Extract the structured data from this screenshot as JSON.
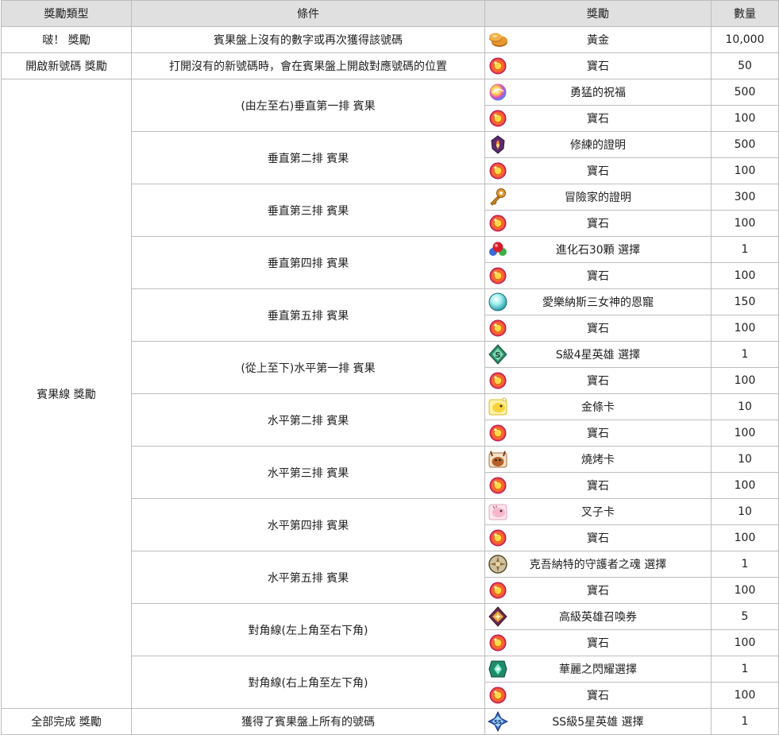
{
  "headers": [
    "獎勵類型",
    "條件",
    "獎勵",
    "數量"
  ],
  "rows": [
    {
      "type": "啵！ 獎勵",
      "condition": "賓果盤上沒有的數字或再次獲得該號碼",
      "rewards": [
        {
          "name": "黃金",
          "qty": "10,000",
          "icon": "gold-coins-icon"
        }
      ]
    },
    {
      "type": "開啟新號碼 獎勵",
      "condition": "打開沒有的新號碼時，會在賓果盤上開啟對應號碼的位置",
      "rewards": [
        {
          "name": "寶石",
          "qty": "50",
          "icon": "gem-icon"
        }
      ]
    },
    {
      "type": "賓果線 獎勵",
      "condition": "(由左至右)垂直第一排 賓果",
      "rewards": [
        {
          "name": "勇猛的祝福",
          "qty": "500",
          "icon": "blessing-orb-icon"
        },
        {
          "name": "寶石",
          "qty": "100",
          "icon": "gem-icon"
        }
      ]
    },
    {
      "condition": "垂直第二排 賓果",
      "rewards": [
        {
          "name": "修練的證明",
          "qty": "500",
          "icon": "training-proof-icon"
        },
        {
          "name": "寶石",
          "qty": "100",
          "icon": "gem-icon"
        }
      ]
    },
    {
      "condition": "垂直第三排 賓果",
      "rewards": [
        {
          "name": "冒險家的證明",
          "qty": "300",
          "icon": "key-icon"
        },
        {
          "name": "寶石",
          "qty": "100",
          "icon": "gem-icon"
        }
      ]
    },
    {
      "condition": "垂直第四排 賓果",
      "rewards": [
        {
          "name": "進化石30顆 選擇",
          "qty": "1",
          "icon": "evolution-stones-icon"
        },
        {
          "name": "寶石",
          "qty": "100",
          "icon": "gem-icon"
        }
      ]
    },
    {
      "condition": "垂直第五排 賓果",
      "rewards": [
        {
          "name": "愛樂納斯三女神的恩寵",
          "qty": "150",
          "icon": "goddess-orb-icon"
        },
        {
          "name": "寶石",
          "qty": "100",
          "icon": "gem-icon"
        }
      ]
    },
    {
      "condition": "(從上至下)水平第一排 賓果",
      "rewards": [
        {
          "name": "S級4星英雄 選擇",
          "qty": "1",
          "icon": "hero-ticket-icon"
        },
        {
          "name": "寶石",
          "qty": "100",
          "icon": "gem-icon"
        }
      ]
    },
    {
      "condition": "水平第二排 賓果",
      "rewards": [
        {
          "name": "金條卡",
          "qty": "10",
          "icon": "gold-bar-card-icon"
        },
        {
          "name": "寶石",
          "qty": "100",
          "icon": "gem-icon"
        }
      ]
    },
    {
      "condition": "水平第三排 賓果",
      "rewards": [
        {
          "name": "燒烤卡",
          "qty": "10",
          "icon": "bbq-card-icon"
        },
        {
          "name": "寶石",
          "qty": "100",
          "icon": "gem-icon"
        }
      ]
    },
    {
      "condition": "水平第四排 賓果",
      "rewards": [
        {
          "name": "叉子卡",
          "qty": "10",
          "icon": "fork-card-icon"
        },
        {
          "name": "寶石",
          "qty": "100",
          "icon": "gem-icon"
        }
      ]
    },
    {
      "condition": "水平第五排 賓果",
      "rewards": [
        {
          "name": "克吾納特的守護者之魂 選擇",
          "qty": "1",
          "icon": "guardian-soul-icon"
        },
        {
          "name": "寶石",
          "qty": "100",
          "icon": "gem-icon"
        }
      ]
    },
    {
      "condition": "對角線(左上角至右下角)",
      "rewards": [
        {
          "name": "高級英雄召喚券",
          "qty": "5",
          "icon": "summon-ticket-icon"
        },
        {
          "name": "寶石",
          "qty": "100",
          "icon": "gem-icon"
        }
      ]
    },
    {
      "condition": "對角線(右上角至左下角)",
      "rewards": [
        {
          "name": "華麗之閃耀選擇",
          "qty": "1",
          "icon": "shine-ticket-icon"
        },
        {
          "name": "寶石",
          "qty": "100",
          "icon": "gem-icon"
        }
      ]
    },
    {
      "type": "全部完成 獎勵",
      "condition": "獲得了賓果盤上所有的號碼",
      "rewards": [
        {
          "name": "SS級5星英雄 選擇",
          "qty": "1",
          "icon": "ss-hero-ticket-icon"
        }
      ]
    }
  ]
}
